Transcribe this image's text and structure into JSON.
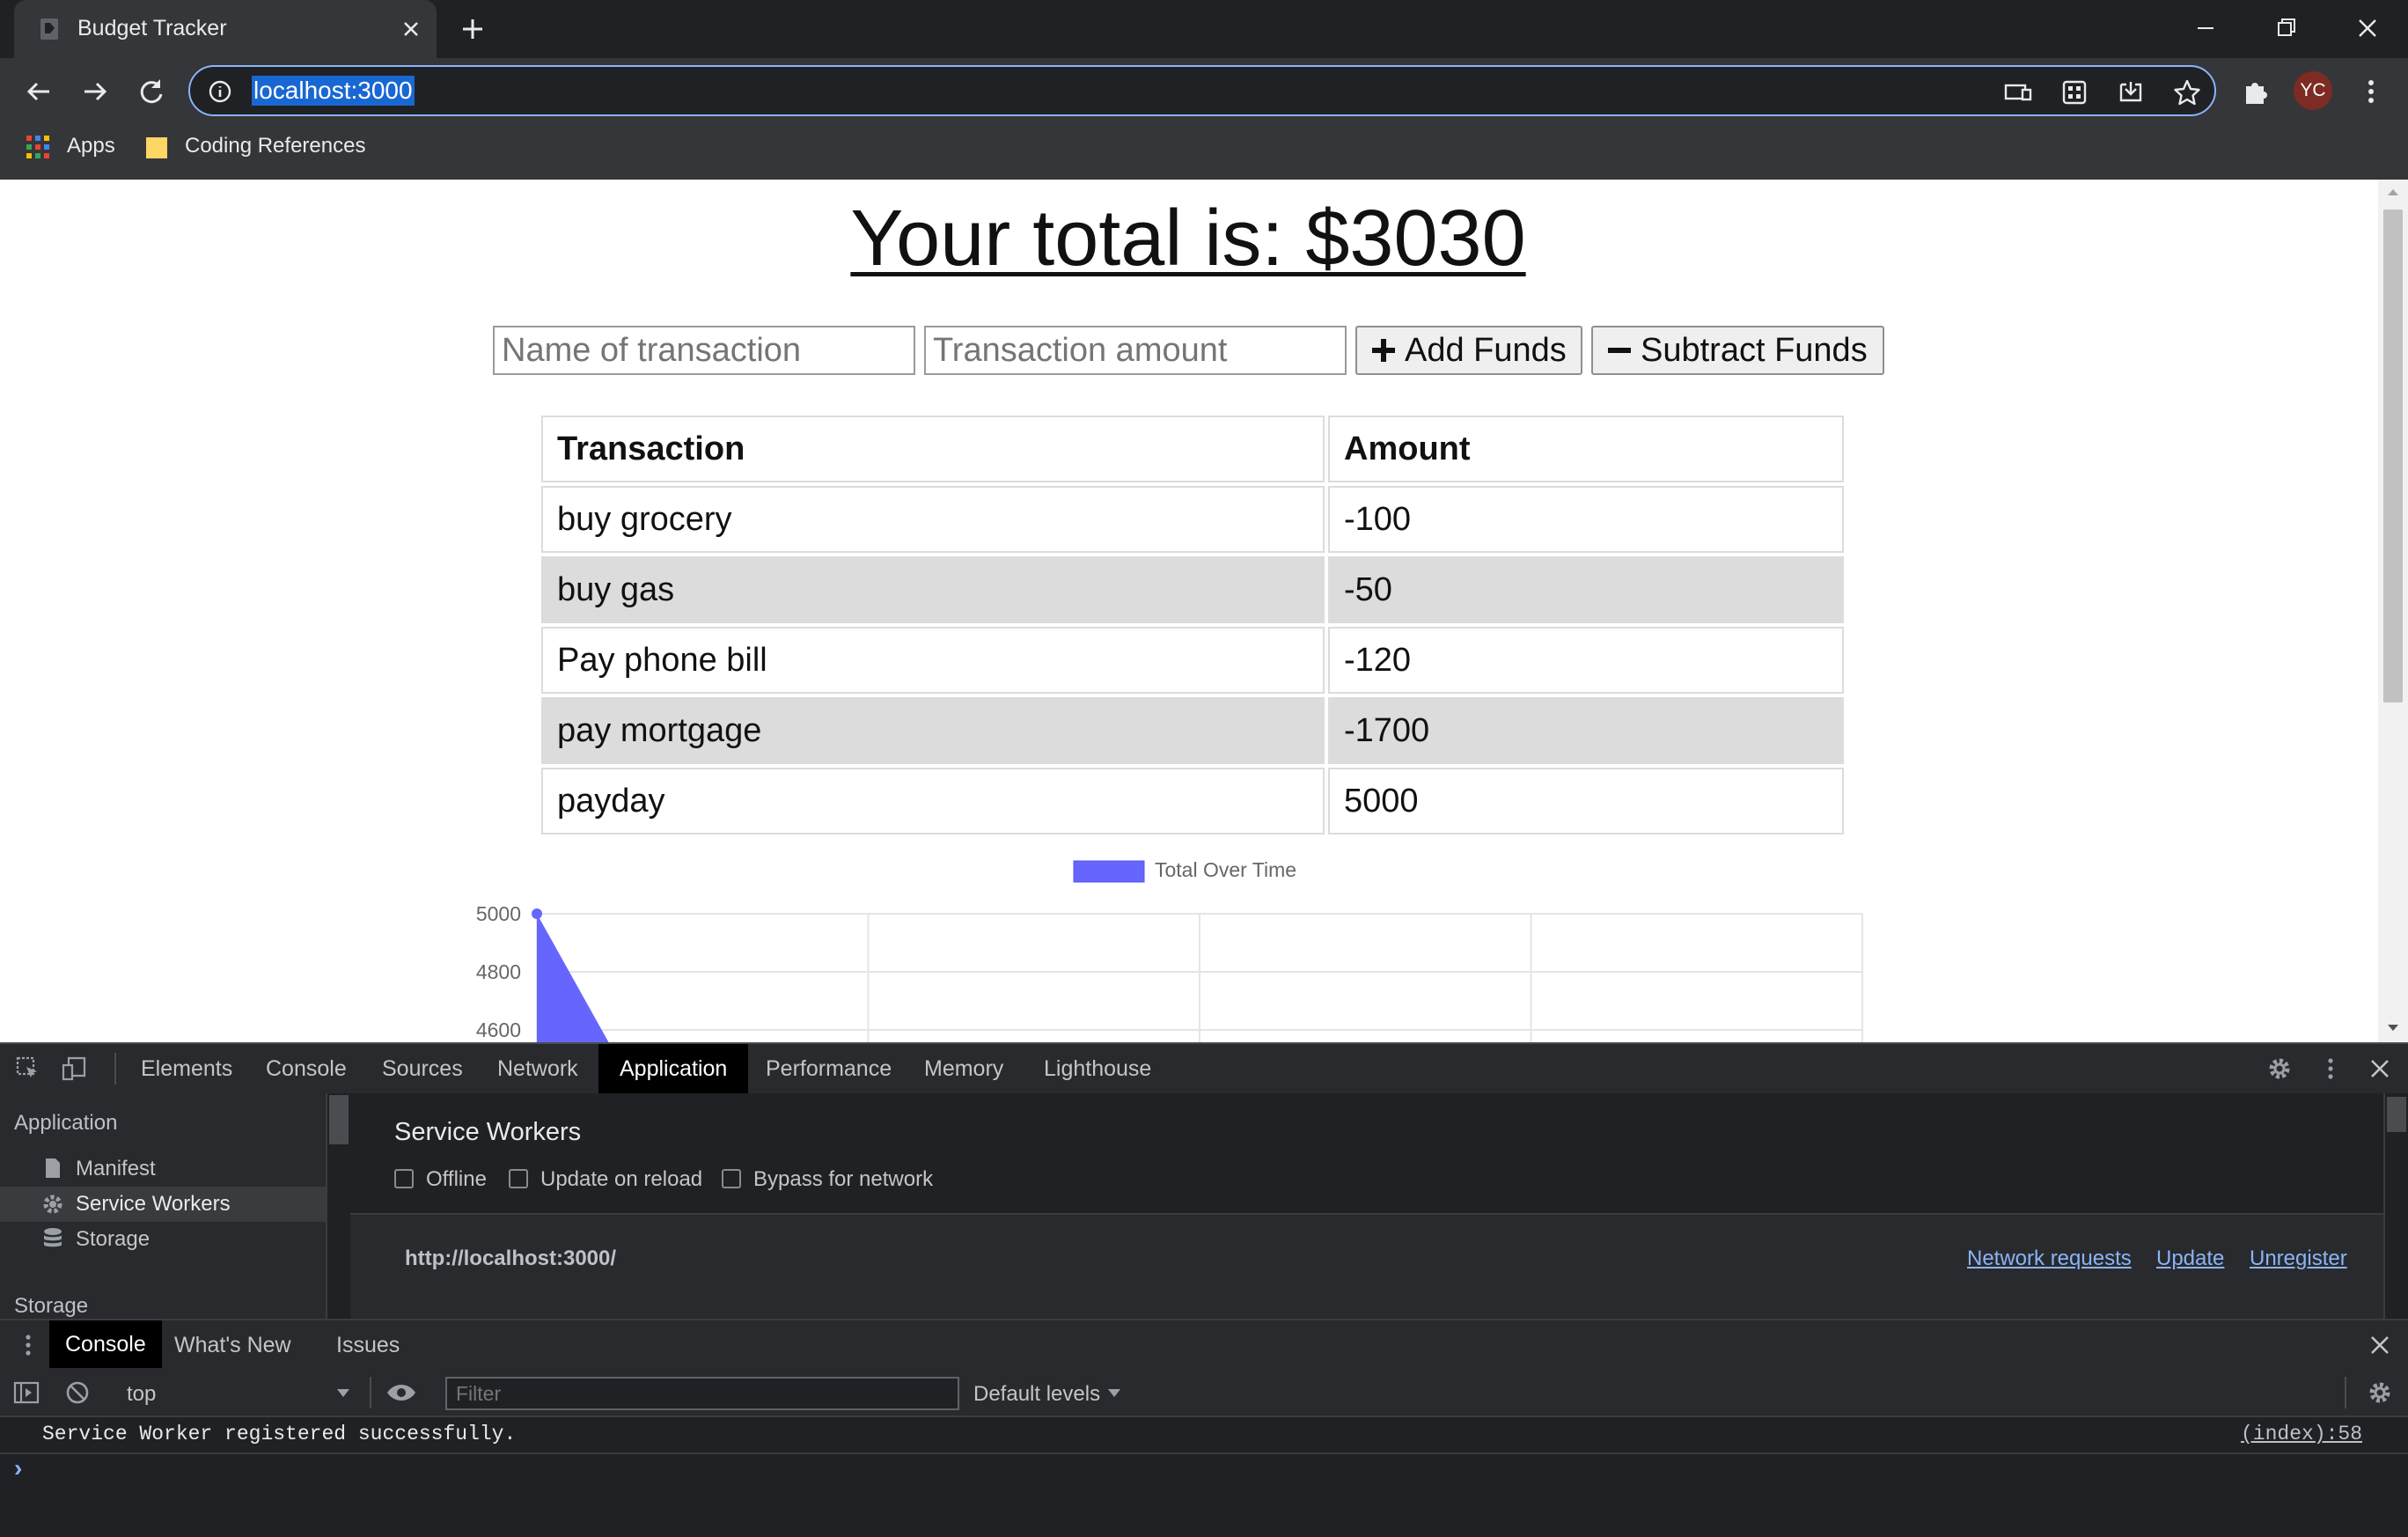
{
  "browser": {
    "tab_title": "Budget Tracker",
    "url": "localhost:3000",
    "avatar_initials": "YC",
    "bookmarks": [
      "Apps",
      "Coding References"
    ]
  },
  "page": {
    "total_heading": "Your total is: $3030",
    "name_placeholder": "Name of transaction",
    "amount_placeholder": "Transaction amount",
    "add_label": "Add Funds",
    "subtract_label": "Subtract Funds",
    "table": {
      "headers": [
        "Transaction",
        "Amount"
      ],
      "rows": [
        [
          "buy grocery",
          "-100"
        ],
        [
          "buy gas",
          "-50"
        ],
        [
          "Pay phone bill",
          "-120"
        ],
        [
          "pay mortgage",
          "-1700"
        ],
        [
          "payday",
          "5000"
        ]
      ]
    }
  },
  "chart_data": {
    "type": "area",
    "title": "",
    "legend": [
      "Total Over Time"
    ],
    "legend_position": "top",
    "series": [
      {
        "name": "Total Over Time",
        "color": "#6666ff",
        "values": [
          5000
        ]
      }
    ],
    "y_ticks": [
      5000,
      4800,
      4600
    ],
    "ylim_visible": [
      4600,
      5000
    ],
    "grid": true
  },
  "devtools": {
    "tabs": [
      "Elements",
      "Console",
      "Sources",
      "Network",
      "Application",
      "Performance",
      "Memory",
      "Lighthouse"
    ],
    "active_tab": "Application",
    "sidebar": {
      "section1": "Application",
      "items": [
        "Manifest",
        "Service Workers",
        "Storage"
      ],
      "selected": "Service Workers",
      "section2": "Storage"
    },
    "service_workers": {
      "title": "Service Workers",
      "options": [
        "Offline",
        "Update on reload",
        "Bypass for network"
      ],
      "origin": "http://localhost:3000/",
      "links": [
        "Network requests",
        "Update",
        "Unregister"
      ]
    },
    "drawer_tabs": [
      "Console",
      "What's New",
      "Issues"
    ],
    "console": {
      "context": "top",
      "filter_placeholder": "Filter",
      "levels": "Default levels",
      "message": "Service Worker registered successfully.",
      "source": "(index):58",
      "prompt": "›"
    }
  },
  "colors": {
    "chrome_bg": "#35363a",
    "titlebar_bg": "#202124",
    "devtools_bg": "#202124",
    "link": "#8ab4f8",
    "chart_fill": "#6666ff"
  }
}
